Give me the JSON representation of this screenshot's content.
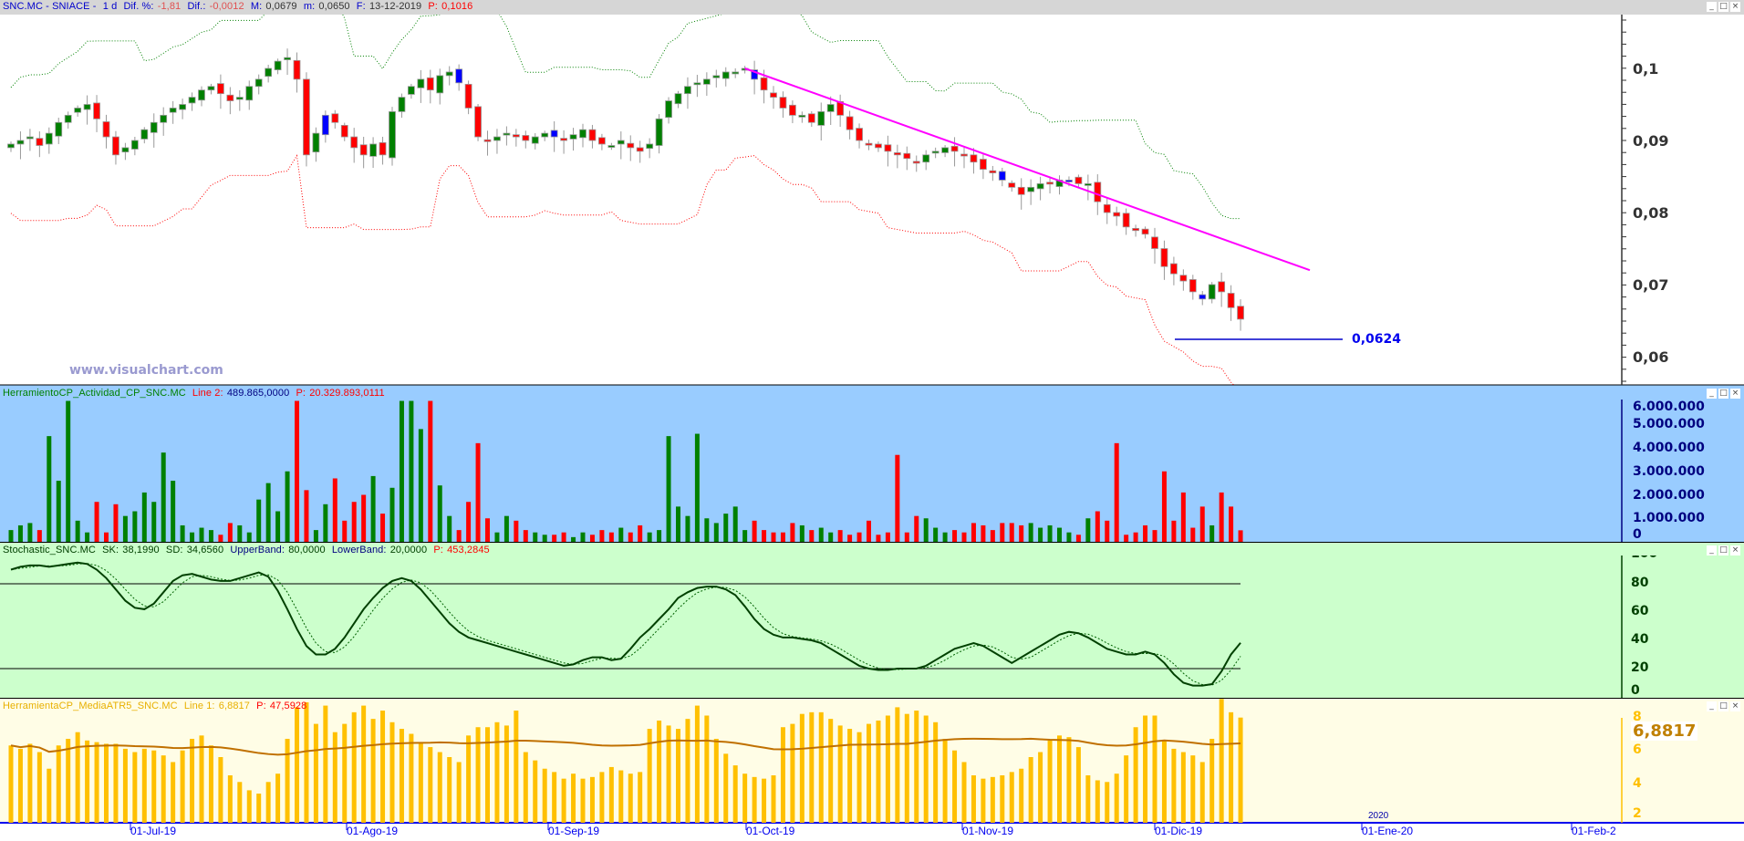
{
  "main": {
    "symbol": "SNC.MC - SNIACE -",
    "period": "1 d",
    "dif_pct_label": "Dif. %:",
    "dif_pct": "-1,81",
    "dif_label": "Dif.:",
    "dif": "-0,0012",
    "max_label": "M:",
    "max": "0,0679",
    "min_label": "m:",
    "min": "0,0650",
    "date_label": "F:",
    "date": "13-12-2019",
    "p_label": "P:",
    "p": "0,1016",
    "watermark": "www.visualchart.com",
    "support_label": "0,0624",
    "yticks": [
      "0,1",
      "0,09",
      "0,08",
      "0,07",
      "0,06"
    ],
    "colors": {
      "up": "#008000",
      "down": "#ff0000",
      "signal": "#0000ff",
      "trendline": "#ff00ff",
      "upper_band": "#008000",
      "lower_band": "#ff0000",
      "support": "#0000cc"
    }
  },
  "volume": {
    "name": "HerramientoCP_Actividad_CP_SNC.MC",
    "line_label": "Line 2:",
    "line_value": "489.865,0000",
    "p_label": "P:",
    "p": "20.329.893,0111",
    "yticks": [
      "6.000.000",
      "5.000.000",
      "4.000.000",
      "3.000.000",
      "2.000.000",
      "1.000.000",
      "0"
    ]
  },
  "stochastic": {
    "name": "Stochastic_SNC.MC",
    "sk_label": "SK:",
    "sk": "38,1990",
    "sd_label": "SD:",
    "sd": "34,6560",
    "upper_label": "UpperBand:",
    "upper": "80,0000",
    "lower_label": "LowerBand:",
    "lower": "20,0000",
    "p_label": "P:",
    "p": "453,2845",
    "yticks": [
      "100",
      "80",
      "60",
      "40",
      "20",
      "0"
    ]
  },
  "atr": {
    "name": "HerramientaCP_MediaATR5_SNC.MC",
    "line_label": "Line 1:",
    "line_value": "6,8817",
    "p_label": "P:",
    "p": "47,5928",
    "current": "6,8817",
    "yticks": [
      "8",
      "6",
      "4",
      "2"
    ]
  },
  "xaxis": {
    "labels": [
      "01-Jul-19",
      "01-Ago-19",
      "01-Sep-19",
      "01-Oct-19",
      "01-Nov-19",
      "01-Dic-19",
      "01-Ene-20",
      "01-Feb-2"
    ],
    "year_label": "2020"
  },
  "window_buttons": {
    "minimize": "_",
    "maximize": "□",
    "close": "×"
  },
  "chart_data": {
    "type": "candlestick",
    "close": [
      0.0895,
      0.09,
      0.0905,
      0.0893,
      0.091,
      0.0925,
      0.0935,
      0.0945,
      0.095,
      0.093,
      0.0905,
      0.088,
      0.089,
      0.09,
      0.0915,
      0.0925,
      0.0935,
      0.0945,
      0.095,
      0.096,
      0.097,
      0.0975,
      0.0965,
      0.0955,
      0.096,
      0.0975,
      0.0985,
      0.1,
      0.101,
      0.1015,
      0.0985,
      0.088,
      0.091,
      0.0935,
      0.0925,
      0.0905,
      0.089,
      0.088,
      0.0895,
      0.088,
      0.094,
      0.096,
      0.0975,
      0.0985,
      0.097,
      0.099,
      0.0995,
      0.098,
      0.0945,
      0.0905,
      0.09,
      0.0905,
      0.091,
      0.0905,
      0.09,
      0.0905,
      0.091,
      0.0905,
      0.09,
      0.0908,
      0.0915,
      0.09,
      0.0895,
      0.0893,
      0.09,
      0.089,
      0.0885,
      0.0895,
      0.093,
      0.0955,
      0.0965,
      0.0975,
      0.098,
      0.0985,
      0.099,
      0.0995,
      0.0995,
      0.1,
      0.0985,
      0.097,
      0.096,
      0.0945,
      0.0935,
      0.0935,
      0.0925,
      0.094,
      0.095,
      0.0935,
      0.0915,
      0.09,
      0.0895,
      0.089,
      0.0885,
      0.088,
      0.0875,
      0.087,
      0.088,
      0.0885,
      0.089,
      0.0885,
      0.088,
      0.087,
      0.086,
      0.0855,
      0.0845,
      0.0835,
      0.0825,
      0.0835,
      0.084,
      0.084,
      0.0845,
      0.0845,
      0.084,
      0.084,
      0.0815,
      0.08,
      0.0795,
      0.078,
      0.0775,
      0.077,
      0.075,
      0.0725,
      0.0715,
      0.0705,
      0.069,
      0.068,
      0.07,
      0.069,
      0.0668,
      0.0652
    ],
    "signal_bars": [
      33,
      47,
      57,
      78,
      104,
      111,
      125
    ],
    "support": 0.0624,
    "trendline": {
      "from_price": 0.1,
      "to_price": 0.072
    },
    "volume": [
      0.5,
      0.7,
      0.8,
      0.5,
      4.5,
      2.6,
      6.0,
      0.9,
      0.4,
      1.7,
      0.4,
      1.6,
      1.1,
      1.3,
      2.1,
      1.7,
      3.8,
      2.6,
      0.7,
      0.4,
      0.6,
      0.5,
      0.3,
      0.8,
      0.7,
      0.4,
      1.8,
      2.5,
      1.3,
      3.0,
      6.0,
      2.2,
      0.5,
      1.6,
      2.7,
      0.9,
      1.7,
      2.0,
      2.8,
      1.2,
      2.3,
      6.0,
      6.0,
      4.8,
      6.0,
      2.4,
      1.1,
      0.5,
      1.7,
      4.2,
      1.0,
      0.4,
      1.1,
      0.9,
      0.5,
      0.4,
      0.3,
      0.3,
      0.4,
      0.2,
      0.4,
      0.3,
      0.5,
      0.4,
      0.6,
      0.4,
      0.7,
      0.4,
      0.5,
      4.5,
      1.5,
      1.1,
      4.6,
      1.0,
      0.8,
      1.2,
      1.5,
      0.5,
      0.9,
      0.5,
      0.4,
      0.4,
      0.8,
      0.7,
      0.5,
      0.6,
      0.4,
      0.5,
      0.3,
      0.4,
      0.9,
      0.3,
      0.4,
      3.7,
      0.4,
      1.1,
      1.0,
      0.6,
      0.4,
      0.5,
      0.4,
      0.8,
      0.7,
      0.5,
      0.8,
      0.8,
      0.7,
      0.8,
      0.6,
      0.7,
      0.6,
      0.4,
      0.3,
      1.0,
      1.3,
      0.9,
      4.2,
      0.3,
      0.4,
      0.7,
      0.5,
      3.0,
      0.9,
      2.1,
      0.6,
      1.5,
      0.7,
      2.1,
      1.5,
      0.49
    ],
    "volume_unit": "millions",
    "stoch_sk": [
      90,
      92,
      93,
      93,
      92,
      93,
      94,
      95,
      94,
      90,
      84,
      76,
      68,
      63,
      62,
      66,
      74,
      82,
      86,
      87,
      85,
      83,
      82,
      82,
      84,
      86,
      88,
      85,
      75,
      62,
      48,
      36,
      30,
      30,
      34,
      42,
      52,
      62,
      70,
      77,
      82,
      84,
      82,
      76,
      68,
      60,
      52,
      46,
      42,
      40,
      38,
      36,
      34,
      32,
      30,
      28,
      26,
      24,
      22,
      23,
      26,
      28,
      28,
      26,
      27,
      34,
      42,
      48,
      55,
      62,
      70,
      74,
      77,
      78,
      78,
      76,
      72,
      64,
      55,
      48,
      44,
      42,
      42,
      41,
      40,
      38,
      34,
      30,
      26,
      22,
      20,
      19,
      19,
      20,
      20,
      20,
      22,
      26,
      30,
      34,
      36,
      38,
      36,
      32,
      28,
      24,
      28,
      32,
      36,
      40,
      44,
      46,
      45,
      42,
      38,
      34,
      32,
      30,
      30,
      32,
      30,
      24,
      16,
      10,
      8,
      8,
      9,
      18,
      30,
      38.2
    ],
    "stoch_bands": [
      80,
      20
    ],
    "atr": [
      5.2,
      5.0,
      5.3,
      4.8,
      3.8,
      5.2,
      5.6,
      6.0,
      5.5,
      5.4,
      5.3,
      5.3,
      5.0,
      4.8,
      5.0,
      4.9,
      4.6,
      4.2,
      4.9,
      5.6,
      5.8,
      5.2,
      4.5,
      3.4,
      3.0,
      2.5,
      2.3,
      3.0,
      3.5,
      5.6,
      7.5,
      7.8,
      6.5,
      7.6,
      6.0,
      6.5,
      7.2,
      7.6,
      6.8,
      7.3,
      6.6,
      6.2,
      5.9,
      5.4,
      5.1,
      4.8,
      4.5,
      4.2,
      5.8,
      6.3,
      6.3,
      6.6,
      6.4,
      7.3,
      4.8,
      4.3,
      3.8,
      3.6,
      3.2,
      3.5,
      3.2,
      3.3,
      3.6,
      3.9,
      3.7,
      3.5,
      3.6,
      6.2,
      6.7,
      6.4,
      6.2,
      6.8,
      7.6,
      7.0,
      5.6,
      4.7,
      4.0,
      3.5,
      3.3,
      3.2,
      3.4,
      6.3,
      6.5,
      7.1,
      7.2,
      7.2,
      6.8,
      6.4,
      6.2,
      6.0,
      6.5,
      6.7,
      7.0,
      7.5,
      7.1,
      7.3,
      7.0,
      6.6,
      5.6,
      4.9,
      4.2,
      3.4,
      3.2,
      3.3,
      3.4,
      3.6,
      3.8,
      4.5,
      4.8,
      5.5,
      5.8,
      5.7,
      5.1,
      3.4,
      3.1,
      3.0,
      3.5,
      4.6,
      6.3,
      7.0,
      7.0,
      5.5,
      5.0,
      4.8,
      4.6,
      4.2,
      5.6,
      8.0,
      7.2,
      6.88
    ],
    "atr_colors": {
      "bars": "#ffc000",
      "average": "#c07000"
    }
  }
}
